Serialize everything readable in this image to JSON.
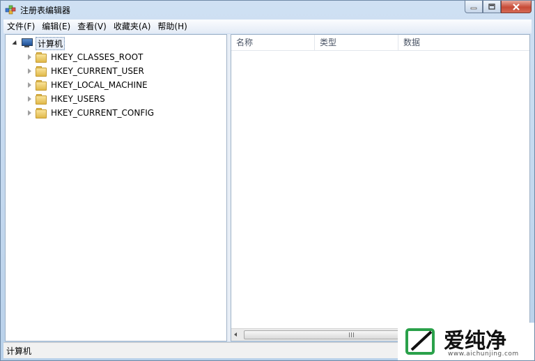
{
  "window": {
    "title": "注册表编辑器"
  },
  "menu": [
    "文件(F)",
    "编辑(E)",
    "查看(V)",
    "收藏夹(A)",
    "帮助(H)"
  ],
  "tree": {
    "root": "计算机",
    "children": [
      "HKEY_CLASSES_ROOT",
      "HKEY_CURRENT_USER",
      "HKEY_LOCAL_MACHINE",
      "HKEY_USERS",
      "HKEY_CURRENT_CONFIG"
    ]
  },
  "list": {
    "columns": [
      "名称",
      "类型",
      "数据"
    ]
  },
  "status": {
    "text": "计算机"
  },
  "watermark": {
    "brand": "爱纯净",
    "url": "www.aichunjing.com"
  }
}
